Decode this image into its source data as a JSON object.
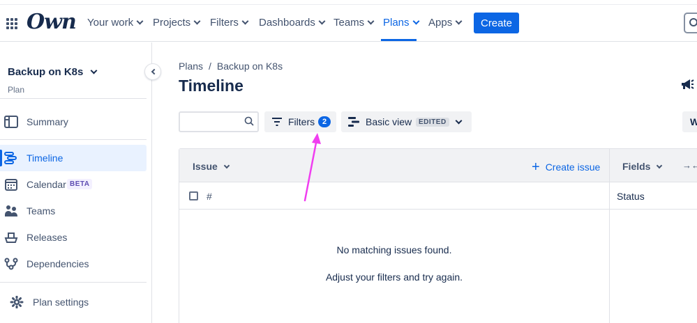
{
  "nav": {
    "logo": "Own",
    "items": [
      {
        "label": "Your work"
      },
      {
        "label": "Projects"
      },
      {
        "label": "Filters"
      },
      {
        "label": "Dashboards"
      },
      {
        "label": "Teams"
      },
      {
        "label": "Plans"
      },
      {
        "label": "Apps"
      }
    ],
    "active": "Plans",
    "create_label": "Create"
  },
  "sidebar": {
    "plan_name": "Backup on K8s",
    "plan_type": "Plan",
    "items": [
      {
        "label": "Summary",
        "icon": "summary-icon"
      },
      {
        "label": "Timeline",
        "icon": "timeline-icon",
        "active": true
      },
      {
        "label": "Calendar",
        "icon": "calendar-icon",
        "badge": "BETA"
      },
      {
        "label": "Teams",
        "icon": "teams-icon"
      },
      {
        "label": "Releases",
        "icon": "releases-icon"
      },
      {
        "label": "Dependencies",
        "icon": "dependencies-icon"
      }
    ],
    "settings_label": "Plan settings"
  },
  "main": {
    "breadcrumb": [
      "Plans",
      "/",
      "Backup on K8s"
    ],
    "title": "Timeline",
    "search_placeholder": "",
    "filters_label": "Filters",
    "filters_count": "2",
    "view_label": "Basic view",
    "view_badge": "EDITED",
    "right_button_label": "W"
  },
  "table": {
    "issue_header": "Issue",
    "create_issue_label": "Create issue",
    "fields_header": "Fields",
    "collapse_glyph": "→←",
    "hash_header": "#",
    "status_header": "Status",
    "empty_title": "No matching issues found.",
    "empty_hint": "Adjust your filters and try again."
  },
  "colors": {
    "accent": "#0c66e4",
    "annotation_arrow": "#f03ef0"
  }
}
